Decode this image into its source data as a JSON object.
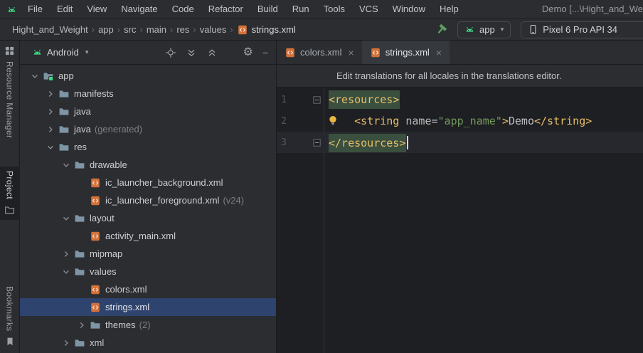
{
  "colors": {
    "android_green": "#3ddc84",
    "selection_blue": "#2e436e",
    "chrome_bg": "#2b2d30",
    "editor_bg": "#1e1f22",
    "xml_tag": "#e8bf6a",
    "xml_attr_value": "#74995e",
    "xml_file_icon_orange": "#d4713a",
    "build_hammer_green": "#5c9a5f",
    "lightbulb_yellow": "#e9b645",
    "tag_match_highlight": "#3a4f3e"
  },
  "menu_bar": {
    "logo_icon": "android-head-icon",
    "items": [
      "File",
      "Edit",
      "View",
      "Navigate",
      "Code",
      "Refactor",
      "Build",
      "Run",
      "Tools",
      "VCS",
      "Window",
      "Help"
    ],
    "window_title": "Demo [...\\Hight_and_We"
  },
  "navbar": {
    "breadcrumbs": [
      {
        "label": "Hight_and_Weight"
      },
      {
        "label": "app"
      },
      {
        "label": "src"
      },
      {
        "label": "main"
      },
      {
        "label": "res"
      },
      {
        "label": "values"
      },
      {
        "label": "strings.xml",
        "icon": "xml-file-icon",
        "current": true
      }
    ],
    "build_icon": "hammer-icon",
    "run_config": {
      "icon": "android-head-icon",
      "label": "app"
    },
    "device_selector": {
      "icon": "phone-icon",
      "label": "Pixel 6 Pro API 34"
    }
  },
  "tool_strip": {
    "top": [
      {
        "label": "Resource Manager",
        "icon": "grid-icon",
        "active": false
      },
      {
        "label": "Project",
        "icon": "folder-icon",
        "active": true
      }
    ],
    "bottom": [
      {
        "label": "Bookmarks",
        "icon": "bookmark-icon",
        "active": false
      }
    ]
  },
  "project_panel": {
    "view_selector": {
      "icon": "android-head-icon",
      "label": "Android"
    },
    "toolbar_icons": [
      "locate-file-icon",
      "expand-all-icon",
      "collapse-all-icon",
      "settings-gear-icon",
      "hide-panel-icon"
    ],
    "tree": [
      {
        "label": "app",
        "level": 0,
        "state": "expanded",
        "icon": "folder-app"
      },
      {
        "label": "manifests",
        "level": 1,
        "state": "collapsed",
        "icon": "folder"
      },
      {
        "label": "java",
        "level": 1,
        "state": "collapsed",
        "icon": "folder"
      },
      {
        "label": "java",
        "suffix": "(generated)",
        "level": 1,
        "state": "collapsed",
        "icon": "folder"
      },
      {
        "label": "res",
        "level": 1,
        "state": "expanded",
        "icon": "folder"
      },
      {
        "label": "drawable",
        "level": 2,
        "state": "expanded",
        "icon": "folder"
      },
      {
        "label": "ic_launcher_background.xml",
        "level": 3,
        "icon": "xml"
      },
      {
        "label": "ic_launcher_foreground.xml",
        "suffix": "(v24)",
        "level": 3,
        "icon": "xml"
      },
      {
        "label": "layout",
        "level": 2,
        "state": "expanded",
        "icon": "folder"
      },
      {
        "label": "activity_main.xml",
        "level": 3,
        "icon": "xml"
      },
      {
        "label": "mipmap",
        "level": 2,
        "state": "collapsed",
        "icon": "folder"
      },
      {
        "label": "values",
        "level": 2,
        "state": "expanded",
        "icon": "folder"
      },
      {
        "label": "colors.xml",
        "level": 3,
        "icon": "xml"
      },
      {
        "label": "strings.xml",
        "level": 3,
        "icon": "xml",
        "selected": true
      },
      {
        "label": "themes",
        "suffix": "(2)",
        "level": 3,
        "state": "collapsed",
        "icon": "folder"
      },
      {
        "label": "xml",
        "level": 2,
        "state": "collapsed",
        "icon": "folder"
      }
    ]
  },
  "editor": {
    "tabs": [
      {
        "label": "colors.xml",
        "icon": "xml",
        "active": false
      },
      {
        "label": "strings.xml",
        "icon": "xml",
        "active": true
      }
    ],
    "banner": "Edit translations for all locales in the translations editor.",
    "code": {
      "language": "xml",
      "lines": [
        {
          "number": "1",
          "fold": true,
          "tokens": [
            {
              "text": "<resources>",
              "cls": "tag",
              "hl": true
            }
          ]
        },
        {
          "number": "2",
          "bulb": true,
          "tokens": [
            {
              "text": "    ",
              "cls": "plain"
            },
            {
              "text": "<string ",
              "cls": "tag"
            },
            {
              "text": "name",
              "cls": "attr"
            },
            {
              "text": "=",
              "cls": "plain"
            },
            {
              "text": "\"app_name\"",
              "cls": "value"
            },
            {
              "text": ">",
              "cls": "tag"
            },
            {
              "text": "Demo",
              "cls": "plain"
            },
            {
              "text": "</string>",
              "cls": "tag"
            }
          ]
        },
        {
          "number": "3",
          "fold": true,
          "caret_line": true,
          "caret": true,
          "tokens": [
            {
              "text": "</resources>",
              "cls": "tag",
              "hl": true
            }
          ]
        }
      ]
    }
  }
}
